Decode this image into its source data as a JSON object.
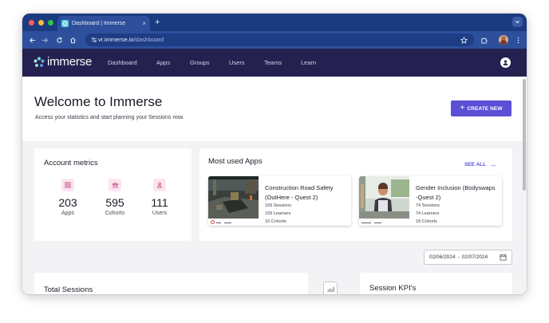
{
  "browser": {
    "tab_title": "Dashboard | Immerse",
    "tab_close": "×",
    "new_tab": "+",
    "url_host": "vr.immerse.io",
    "url_path": "/dashboard"
  },
  "app": {
    "brand": "immerse",
    "nav": [
      "Dashboard",
      "Apps",
      "Groups",
      "Users",
      "Teams",
      "Learn"
    ],
    "accent": "#5b4fd6",
    "nav_bg": "#24204f"
  },
  "hero": {
    "title": "Welcome to Immerse",
    "subtitle": "Access your statistics and start planning your Sessions now.",
    "create_label": "CREATE NEW"
  },
  "metrics": {
    "title": "Account metrics",
    "items": [
      {
        "value": "203",
        "label": "Apps",
        "icon": "grid-icon"
      },
      {
        "value": "595",
        "label": "Cohorts",
        "icon": "group-icon"
      },
      {
        "value": "111",
        "label": "Users",
        "icon": "user-icon"
      }
    ]
  },
  "most_used": {
    "title": "Most used Apps",
    "see_all": "SEE ALL",
    "apps": [
      {
        "name": "Construction Road Safety (OutHere - Quest 2)",
        "sessions": "109 Sessions",
        "learners": "109 Learners",
        "cohorts": "10 Cohorts"
      },
      {
        "name": "Gender Inclusion (Bodyswaps -Quest 2)",
        "sessions": "74 Sessions",
        "learners": "74 Learners",
        "cohorts": "18 Cohorts"
      }
    ]
  },
  "date_range": {
    "start": "02/06/2024",
    "separator": "-",
    "end": "02/07/2024"
  },
  "total_sessions": {
    "title": "Total Sessions"
  },
  "session_kpis": {
    "title": "Session KPI's"
  }
}
